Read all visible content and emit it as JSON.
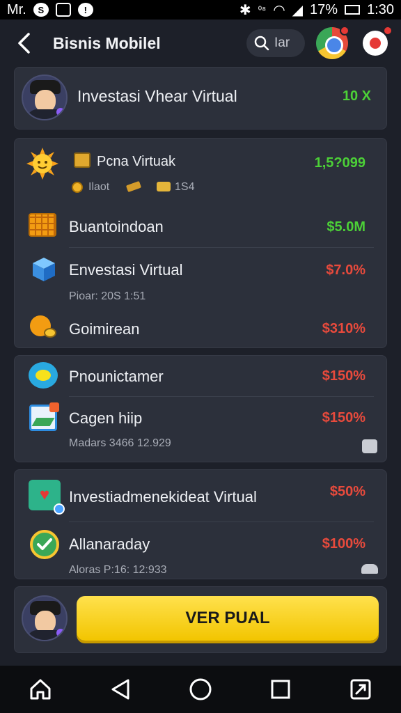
{
  "status_bar": {
    "carrier": "Mr.",
    "battery": "17%",
    "time": "1:30"
  },
  "app_bar": {
    "title": "Bisnis Mobilel",
    "search_text": "Iar"
  },
  "header_card": {
    "title": "Investasi Vhear Virtual",
    "value": "10 X"
  },
  "card1": {
    "rows": [
      {
        "label": "Pcna Virtuak",
        "value": "1,5?099",
        "sub": [
          "Ilaot",
          "1S4"
        ]
      },
      {
        "label": "Buantoindoan",
        "value": "$5.0M"
      },
      {
        "label": "Envestasi Virtual",
        "value": "$7.0%",
        "sub_text": "Pioar: 20S 1:51"
      },
      {
        "label": "Goimirean",
        "value": "$310%"
      }
    ]
  },
  "card2": {
    "rows": [
      {
        "label": "Pnounictamer",
        "value": "$150%"
      },
      {
        "label": "Cagen  hiip",
        "value": "$150%",
        "sub_text": "Madars 3466 12.929"
      }
    ]
  },
  "card3": {
    "rows": [
      {
        "label": "Investiadmenekideat Virtual",
        "value": "$50%"
      },
      {
        "label": "Allanaraday",
        "value": "$100%",
        "sub_text": "Aloras P:16: 12:933"
      }
    ]
  },
  "cta": {
    "label": "VER PUAL"
  },
  "colors": {
    "accent_green": "#4cd137",
    "accent_red": "#e84a3c",
    "cta_yellow": "#f2c500"
  }
}
